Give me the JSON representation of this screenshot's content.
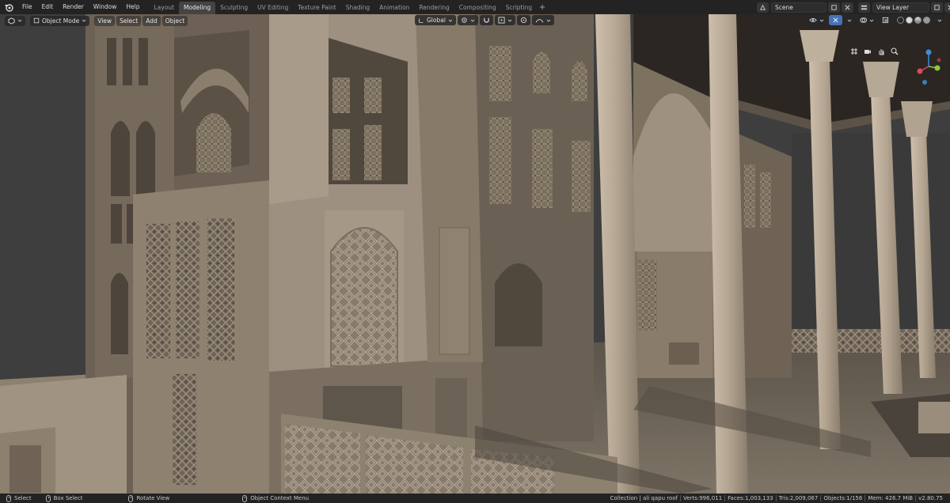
{
  "topbar": {
    "logo_icon": "blender-logo-icon",
    "menu": [
      "File",
      "Edit",
      "Render",
      "Window",
      "Help"
    ],
    "workspaces": [
      "Layout",
      "Modeling",
      "Sculpting",
      "UV Editing",
      "Texture Paint",
      "Shading",
      "Animation",
      "Rendering",
      "Compositing",
      "Scripting"
    ],
    "active_workspace": "Modeling",
    "add_workspace_label": "+",
    "scene_name": "Scene",
    "view_layer": "View Layer"
  },
  "viewport_header": {
    "editor_type_icon": "3d-viewport-icon",
    "mode": "Object Mode",
    "menus": [
      "View",
      "Select",
      "Add",
      "Object"
    ],
    "transform_orientation": "Global",
    "pivot_icon": "pivot-icon",
    "snap_icon": "magnet-icon",
    "proportional_icon": "proportional-edit-icon",
    "active_shading": "solid",
    "accent_color": "#4772b3"
  },
  "statusbar": {
    "hints": [
      {
        "key": "Select",
        "icon": "mouse-left-icon"
      },
      {
        "key": "Box Select",
        "icon": "mouse-drag-icon"
      },
      {
        "key": "Rotate View",
        "icon": "mouse-middle-icon"
      },
      {
        "key": "Object Context Menu",
        "icon": "mouse-right-icon"
      }
    ],
    "stats": [
      "Collection | ali qapu roof",
      "Verts:996,011",
      "Faces:1,003,133",
      "Tris:2,009,067",
      "Objects:1/156",
      "Mem: 426.7 MiB",
      "v2.80.75"
    ]
  },
  "gizmo": {
    "x_color": "#e0485a",
    "y_color": "#8acb3c",
    "z_color": "#3f8bdc"
  }
}
